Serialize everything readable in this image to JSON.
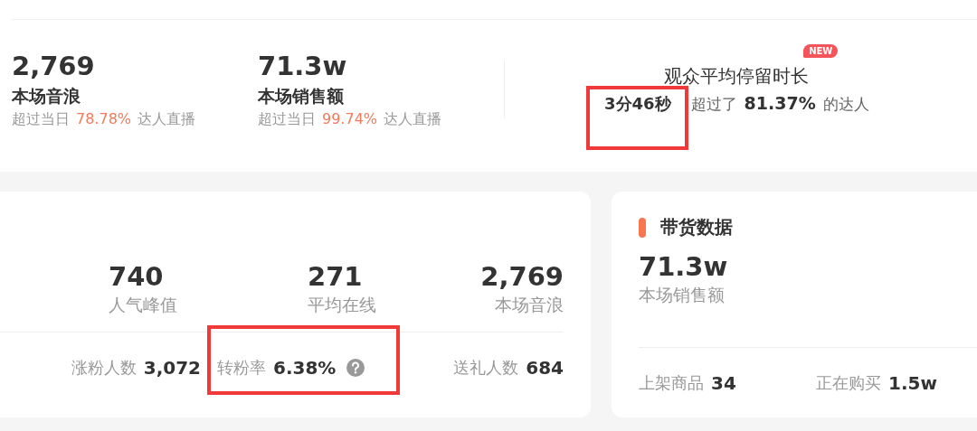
{
  "overview": {
    "stats": [
      {
        "value": "2,769",
        "label": "本场音浪",
        "note_prefix": "超过当日",
        "percent": "78.78%",
        "note_suffix": "达人直播"
      },
      {
        "value": "71.3w",
        "label": "本场销售额",
        "note_prefix": "超过当日",
        "percent": "99.74%",
        "note_suffix": "达人直播"
      }
    ],
    "dwell": {
      "title": "观众平均停留时长",
      "badge": "NEW",
      "value": "3分46秒",
      "prefix": "超过了",
      "percent": "81.37%",
      "suffix": "的达人"
    }
  },
  "traffic_card": {
    "stats": [
      {
        "value": "740",
        "label": "人气峰值"
      },
      {
        "value": "271",
        "label": "平均在线"
      },
      {
        "value": "2,769",
        "label": "本场音浪"
      }
    ],
    "metrics": [
      {
        "label": "涨粉人数",
        "value": "3,072",
        "help": false
      },
      {
        "label": "转粉率",
        "value": "6.38%",
        "help": true
      },
      {
        "label": "送礼人数",
        "value": "684",
        "help": false
      }
    ]
  },
  "sales_card": {
    "title": "带货数据",
    "stats": [
      {
        "value": "71.3w",
        "label": "本场销售额"
      }
    ],
    "metrics": [
      {
        "label": "上架商品",
        "value": "34"
      },
      {
        "label": "正在购买",
        "value": "1.5w"
      }
    ]
  }
}
